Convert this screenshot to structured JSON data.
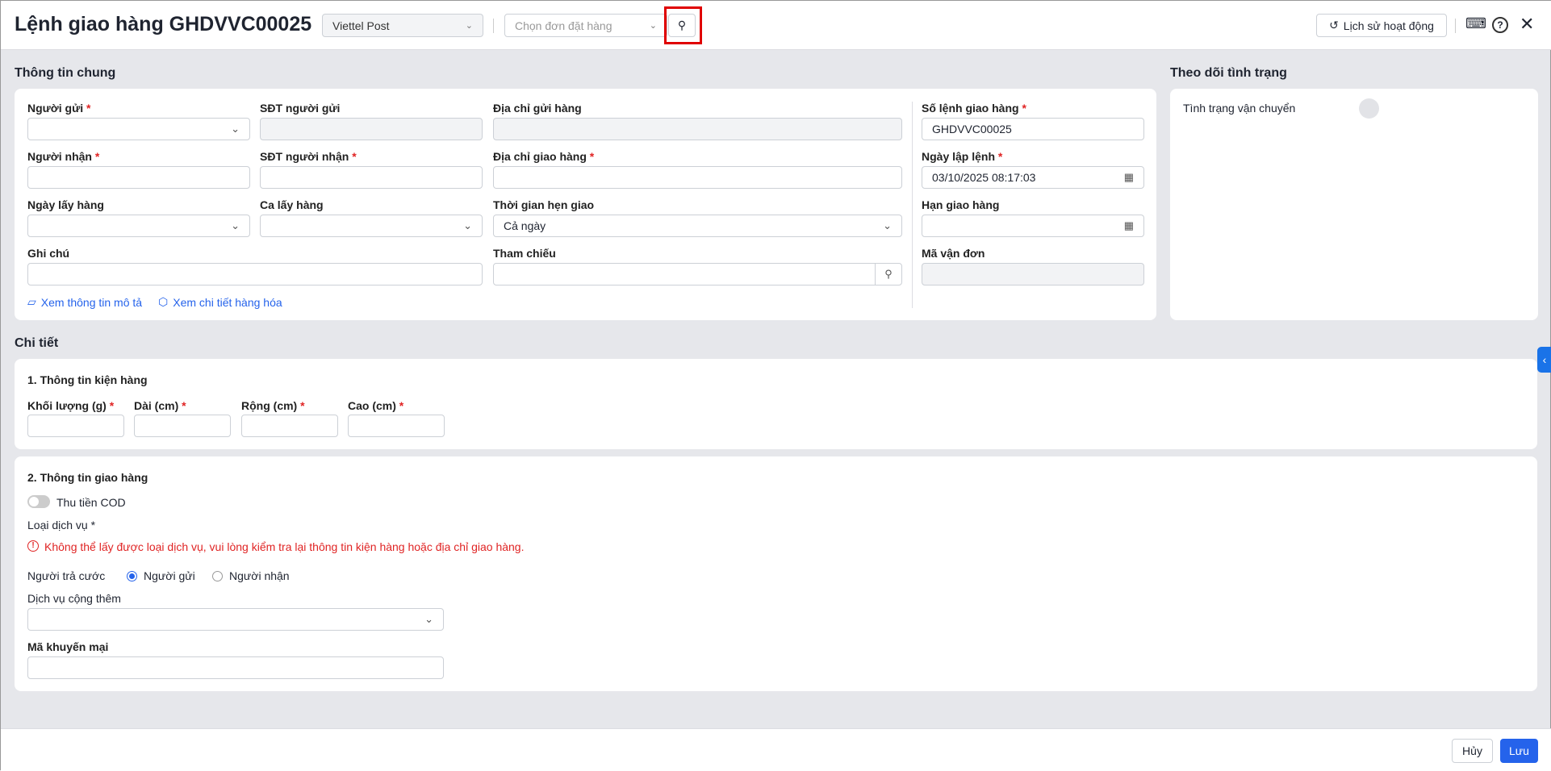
{
  "header": {
    "title": "Lệnh giao hàng GHDVVC00025",
    "carrier": "Viettel Post",
    "order_placeholder": "Chọn đơn đặt hàng",
    "history_label": "Lịch sử hoạt động"
  },
  "general": {
    "section_title": "Thông tin chung",
    "sender_label": "Người gửi",
    "sender_phone_label": "SĐT người gửi",
    "sender_address_label": "Địa chỉ gửi hàng",
    "receiver_label": "Người nhận",
    "receiver_phone_label": "SĐT người nhận",
    "delivery_address_label": "Địa chỉ giao hàng",
    "pickup_date_label": "Ngày lấy hàng",
    "pickup_shift_label": "Ca lấy hàng",
    "delivery_time_label": "Thời gian hẹn giao",
    "delivery_time_value": "Cả ngày",
    "note_label": "Ghi chú",
    "reference_label": "Tham chiếu",
    "order_no_label": "Số lệnh giao hàng",
    "order_no_value": "GHDVVC00025",
    "created_label": "Ngày lập lệnh",
    "created_value": "03/10/2025 08:17:03",
    "deadline_label": "Hạn giao hàng",
    "waybill_label": "Mã vận đơn",
    "link_description": "Xem thông tin mô tả",
    "link_goods": "Xem chi tiết hàng hóa",
    "required_mark": "*"
  },
  "tracking": {
    "section_title": "Theo dõi tình trạng",
    "status_label": "Tình trạng vận chuyển"
  },
  "detail": {
    "section_title": "Chi tiết",
    "package": {
      "title": "1. Thông tin kiện hàng",
      "weight": "Khối lượng (g)",
      "length": "Dài (cm)",
      "width": "Rộng (cm)",
      "height": "Cao (cm)"
    },
    "delivery": {
      "title": "2. Thông tin giao hàng",
      "cod_label": "Thu tiền COD",
      "service_label": "Loại dịch vụ *",
      "error": "Không thể lấy được loại dịch vụ, vui lòng kiểm tra lại thông tin kiện hàng hoặc địa chỉ giao hàng.",
      "payer_label": "Người trả cước",
      "payer_sender": "Người gửi",
      "payer_receiver": "Người nhận",
      "extra_label": "Dịch vụ cộng thêm",
      "promo_label": "Mã khuyến mại"
    }
  },
  "footer": {
    "cancel": "Hủy",
    "save": "Lưu"
  },
  "colors": {
    "accent": "#2563eb",
    "error": "#e02424",
    "highlight": "#e00000"
  }
}
